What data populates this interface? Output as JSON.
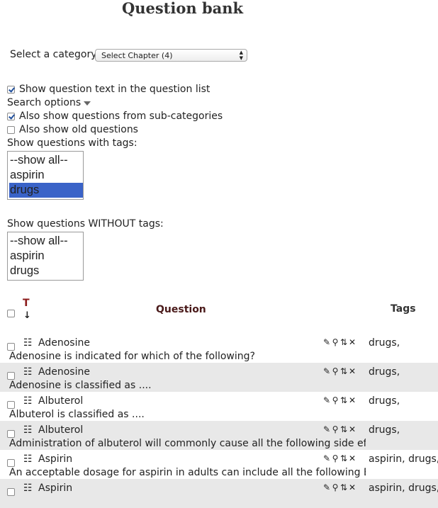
{
  "page": {
    "title": "Question bank"
  },
  "category": {
    "label": "Select a category:",
    "selected": "Select Chapter (4)"
  },
  "options": {
    "show_text_label": "Show question text in the question list",
    "search_options_label": "Search options",
    "sub_categories_label": "Also show questions from sub-categories",
    "old_questions_label": "Also show old questions",
    "with_tags_label": "Show questions with tags:",
    "without_tags_label": "Show questions WITHOUT tags:"
  },
  "with_tags": [
    "--show all--",
    "aspirin",
    "drugs"
  ],
  "without_tags": [
    "--show all--",
    "aspirin",
    "drugs"
  ],
  "table": {
    "col_type": "T",
    "col_sort": "↓",
    "col_question": "Question",
    "col_tags": "Tags",
    "header_color": "#4a1a1a"
  },
  "questions": [
    {
      "name": "Adenosine",
      "text": "Adenosine is indicated for which of the following?",
      "tags": "drugs,"
    },
    {
      "name": "Adenosine",
      "text": "Adenosine is classified as ....",
      "tags": "drugs,"
    },
    {
      "name": "Albuterol",
      "text": "Albuterol is classified as ....",
      "tags": "drugs,"
    },
    {
      "name": "Albuterol",
      "text": "Administration of albuterol will commonly cause all the following side effe",
      "tags": "drugs,"
    },
    {
      "name": "Aspirin",
      "text": "An acceptable dosage for aspirin in adults can include all the following EX",
      "tags": "aspirin, drugs,"
    },
    {
      "name": "Aspirin",
      "text": "",
      "tags": "aspirin, drugs,"
    }
  ],
  "icons": {
    "type": "☷",
    "edit": "✎",
    "preview": "⚲",
    "move": "⇅",
    "delete": "✕"
  }
}
